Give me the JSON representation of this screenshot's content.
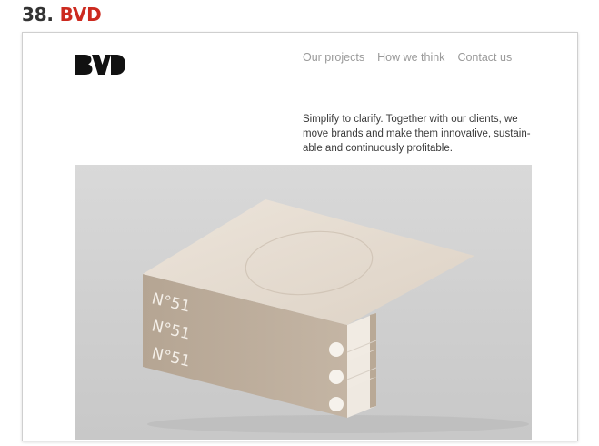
{
  "heading": {
    "number": "38.",
    "name": "BVD"
  },
  "site": {
    "logo_text": "BVD",
    "nav": [
      "Our projects",
      "How we think",
      "Contact us"
    ],
    "tagline_lines": [
      "Simplify to clarify. Together with our clients, we",
      "move brands and make them innovative, sustain-",
      "able and continuously profitable."
    ]
  },
  "books": {
    "spine_labels": [
      "N°51",
      "N°51",
      "N°51"
    ]
  },
  "colors": {
    "accent": "#cc2a1f",
    "nav_text": "#9a9a9a",
    "book_cover": "#e6dcd0",
    "book_spine": "#b8a897"
  }
}
